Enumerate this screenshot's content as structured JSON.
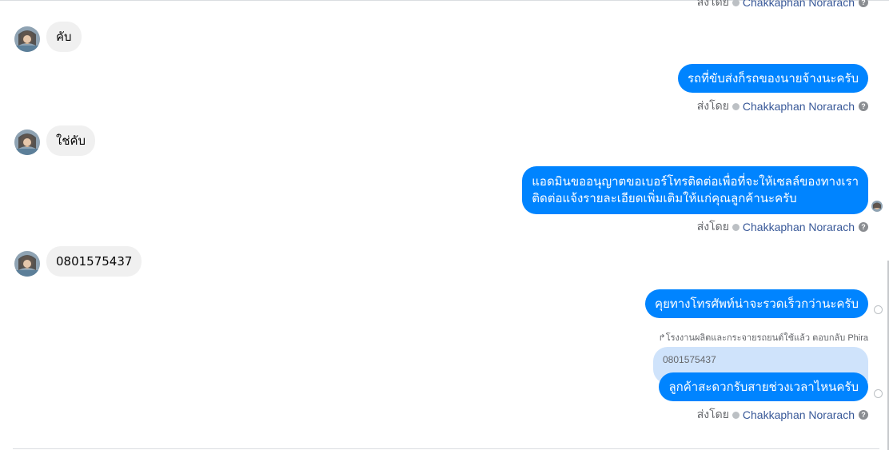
{
  "conversation": {
    "messages": [
      {
        "id": "m0",
        "direction": "out",
        "sent_by_label": "ส่งโดย",
        "sent_by_name": "Chakkaphan Norarach"
      },
      {
        "id": "m1",
        "direction": "in",
        "text": "คับ"
      },
      {
        "id": "m2",
        "direction": "out",
        "text": "รถที่ขับส่งก็รถของนายจ้างนะครับ",
        "sent_by_label": "ส่งโดย",
        "sent_by_name": "Chakkaphan Norarach"
      },
      {
        "id": "m3",
        "direction": "in",
        "text": "ใช่คับ"
      },
      {
        "id": "m4",
        "direction": "out",
        "lines": [
          "แอดมินขออนุญาตขอเบอร์โทรติดต่อเพื่อที่จะให้เซลล์ของทางเรา",
          "ติดต่อแจ้งรายละเอียดเพิ่มเติมให้แก่คุณลูกค้านะครับ"
        ],
        "sent_by_label": "ส่งโดย",
        "sent_by_name": "Chakkaphan Norarach"
      },
      {
        "id": "m5",
        "direction": "in",
        "text": "0801575437"
      },
      {
        "id": "m6",
        "direction": "out",
        "text": "คุยทางโทรศัพท์น่าจะรวดเร็วกว่านะครับ"
      },
      {
        "id": "m7",
        "direction": "out",
        "reply_header": "โรงงานผลิตและกระจายรถยนต์ใช้แล้ว ตอบกลับ Phira",
        "quoted_text": "0801575437",
        "text": "ลูกค้าสะดวกรับสายช่วงเวลาไหนครับ",
        "sent_by_label": "ส่งโดย",
        "sent_by_name": "Chakkaphan Norarach"
      }
    ],
    "help_glyph": "?",
    "reply_icon": "reply-arrow-icon",
    "colors": {
      "outgoing_bubble": "#0084ff",
      "incoming_bubble": "#f0f0f0",
      "quoted_bubble": "#cfe3fb",
      "sender_name": "#385898",
      "meta_text": "#65676b"
    }
  }
}
